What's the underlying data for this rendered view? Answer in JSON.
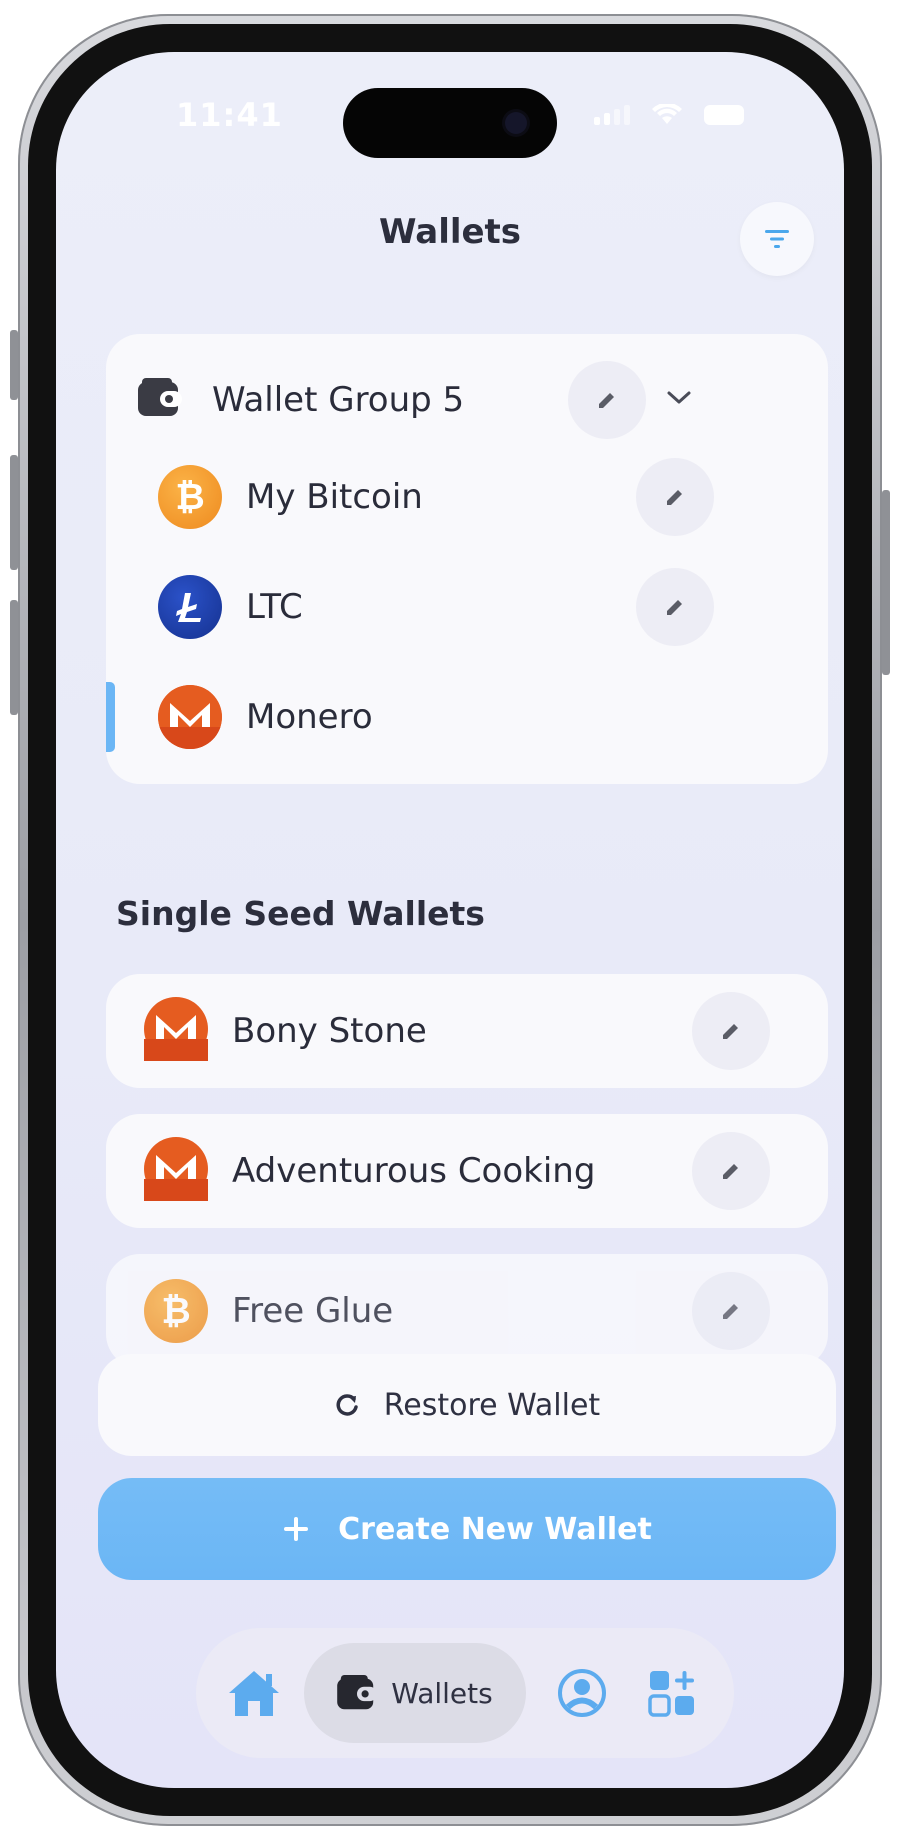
{
  "status_bar": {
    "time": "11:41"
  },
  "header": {
    "title": "Wallets"
  },
  "wallet_group": {
    "name": "Wallet Group 5",
    "wallets": [
      {
        "name": "My Bitcoin",
        "coin": "bitcoin-icon"
      },
      {
        "name": "LTC",
        "coin": "litecoin-icon"
      },
      {
        "name": "Monero",
        "coin": "monero-icon",
        "selected": true
      }
    ]
  },
  "single_seed": {
    "title": "Single Seed Wallets",
    "wallets": [
      {
        "name": "Bony Stone",
        "coin": "monero-icon"
      },
      {
        "name": "Adventurous Cooking",
        "coin": "monero-icon"
      },
      {
        "name": "Free Glue",
        "coin": "bitcoin-icon"
      }
    ]
  },
  "actions": {
    "restore_label": "Restore Wallet",
    "create_label": "Create New Wallet"
  },
  "tabbar": {
    "items": [
      {
        "icon": "home-icon"
      },
      {
        "icon": "wallet-icon",
        "label": "Wallets",
        "active": true
      },
      {
        "icon": "profile-icon"
      },
      {
        "icon": "apps-icon"
      }
    ]
  },
  "colors": {
    "accent": "#6bb6f5",
    "bitcoin": "#f39a2e",
    "litecoin": "#1d3ea8",
    "monero": "#e55c20",
    "text": "#2a2c3a"
  }
}
